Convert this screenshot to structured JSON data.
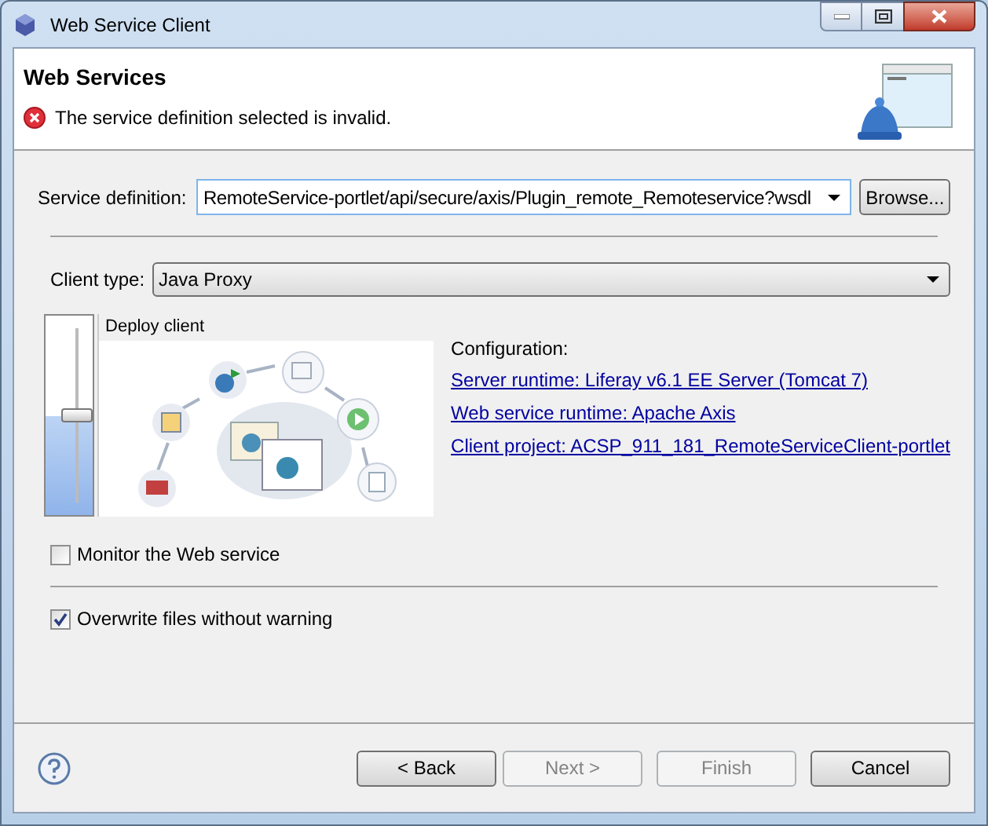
{
  "window": {
    "title": "Web Service Client"
  },
  "header": {
    "title": "Web Services",
    "message": "The service definition selected is invalid."
  },
  "service_definition": {
    "label": "Service definition:",
    "value": "RemoteService-portlet/api/secure/axis/Plugin_remote_Remoteservice?wsdl",
    "browse": "Browse..."
  },
  "client_type": {
    "label": "Client type:",
    "value": "Java Proxy"
  },
  "deploy": {
    "title": "Deploy client",
    "level": 0.5
  },
  "configuration": {
    "label": "Configuration:",
    "links": [
      "Server runtime: Liferay v6.1 EE Server (Tomcat 7)",
      "Web service runtime: Apache Axis",
      "Client project: ACSP_911_181_RemoteServiceClient-portlet"
    ]
  },
  "options": [
    {
      "label": "Monitor the Web service",
      "checked": false
    },
    {
      "label": "Overwrite files without warning",
      "checked": true
    }
  ],
  "buttons": [
    {
      "label": "< Back",
      "disabled": false
    },
    {
      "label": "Next >",
      "disabled": true
    },
    {
      "label": "Finish",
      "disabled": true
    },
    {
      "label": "Cancel",
      "disabled": false
    }
  ]
}
